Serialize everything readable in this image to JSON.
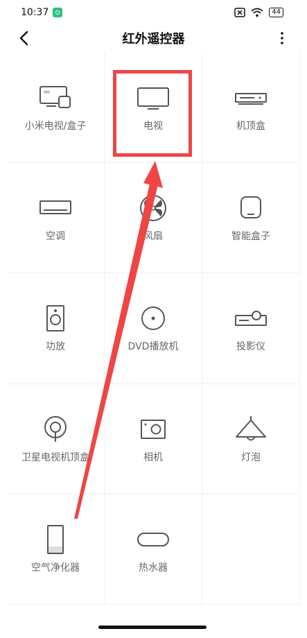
{
  "status_bar": {
    "time": "10:37",
    "battery": "44"
  },
  "header": {
    "title": "红外遥控器"
  },
  "devices": [
    {
      "label": "小米电视/盒子",
      "icon": "mi-tv-box-icon"
    },
    {
      "label": "电视",
      "icon": "tv-icon"
    },
    {
      "label": "机顶盒",
      "icon": "set-top-box-icon"
    },
    {
      "label": "空调",
      "icon": "air-conditioner-icon"
    },
    {
      "label": "风扇",
      "icon": "fan-icon"
    },
    {
      "label": "智能盒子",
      "icon": "smart-box-icon"
    },
    {
      "label": "功放",
      "icon": "amplifier-icon"
    },
    {
      "label": "DVD播放机",
      "icon": "dvd-player-icon"
    },
    {
      "label": "投影仪",
      "icon": "projector-icon"
    },
    {
      "label": "卫星电视机顶盒",
      "icon": "satellite-box-icon"
    },
    {
      "label": "相机",
      "icon": "camera-icon"
    },
    {
      "label": "灯泡",
      "icon": "lamp-icon"
    },
    {
      "label": "空气净化器",
      "icon": "air-purifier-icon"
    },
    {
      "label": "热水器",
      "icon": "water-heater-icon"
    }
  ],
  "annotation": {
    "highlight_color": "#f04545"
  }
}
